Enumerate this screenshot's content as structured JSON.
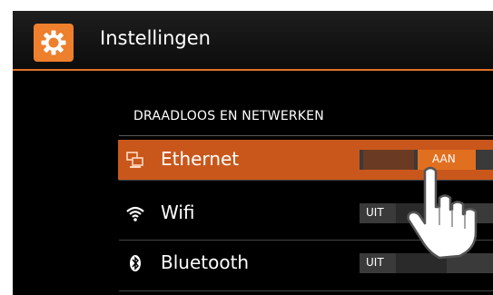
{
  "app": {
    "title": "Instellingen",
    "icon": "gear-icon",
    "accent": "#e2702a"
  },
  "section": {
    "header": "DRAADLOOS EN NETWERKEN"
  },
  "rows": [
    {
      "label": "Ethernet",
      "icon": "ethernet-icon",
      "toggle": "AAN",
      "selected": true
    },
    {
      "label": "Wifi",
      "icon": "wifi-icon",
      "toggle": "UIT",
      "selected": false
    },
    {
      "label": "Bluetooth",
      "icon": "bluetooth-icon",
      "toggle": "UIT",
      "selected": false
    }
  ],
  "overlay": {
    "icon": "hand-pointer-icon"
  }
}
